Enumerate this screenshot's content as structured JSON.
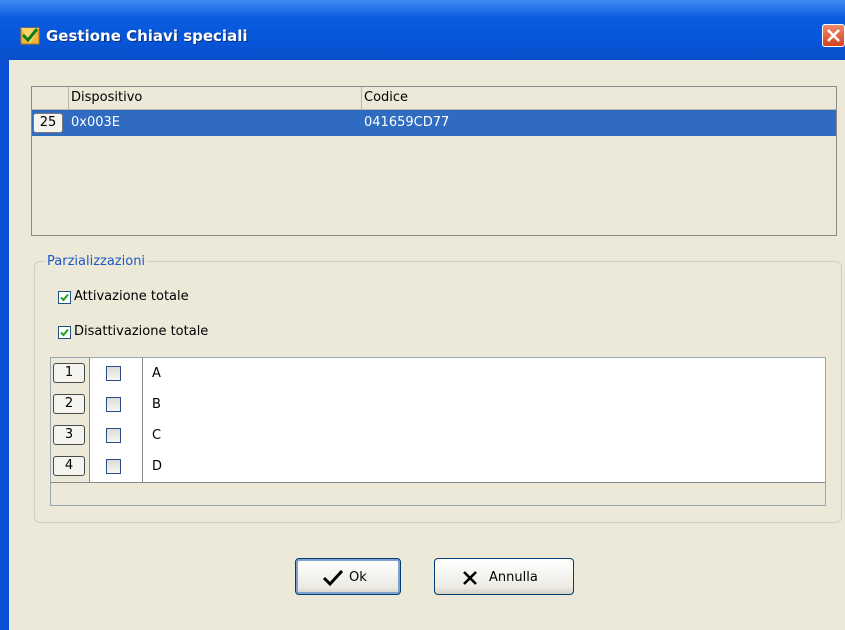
{
  "window": {
    "title": "Gestione Chiavi speciali",
    "app_icon": "shield-check-icon",
    "close_icon": "close-icon"
  },
  "devices_table": {
    "columns": [
      "Dispositivo",
      "Codice"
    ],
    "rows": [
      {
        "index": "25",
        "dispositivo": "0x003E",
        "codice": "041659CD77",
        "selected": true
      }
    ]
  },
  "parzializzazioni": {
    "title": "Parzializzazioni",
    "attivazione_totale": {
      "label": "Attivazione totale",
      "checked": true
    },
    "disattivazione_totale": {
      "label": "Disattivazione totale",
      "checked": true
    },
    "partitions": [
      {
        "index": "1",
        "name": "A",
        "checked": false
      },
      {
        "index": "2",
        "name": "B",
        "checked": false
      },
      {
        "index": "3",
        "name": "C",
        "checked": false
      },
      {
        "index": "4",
        "name": "D",
        "checked": false
      }
    ]
  },
  "buttons": {
    "ok": "Ok",
    "cancel": "Annulla"
  },
  "colors": {
    "titlebar": "#0755d8",
    "selection": "#2f6bc0",
    "dialog_bg": "#ece9d8",
    "group_label": "#1c58c9"
  }
}
